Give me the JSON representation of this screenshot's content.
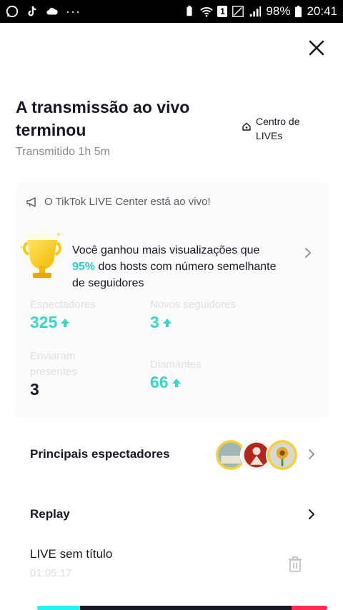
{
  "status_bar": {
    "icons_left": [
      "whatsapp-icon",
      "tiktok-icon",
      "cloud-icon"
    ],
    "more_dots": "···",
    "sim_badge": "1",
    "battery": "98%",
    "time": "20:41"
  },
  "header": {
    "title": "A transmissão ao vivo terminou",
    "duration": "Transmitido 1h 5m",
    "live_center_label": "Centro de LIVEs"
  },
  "card": {
    "notice": "O TikTok LIVE Center está ao vivo!",
    "achievement_prefix": "Você ganhou mais visualizações que ",
    "achievement_percent": "95%",
    "achievement_suffix": " dos hosts com número semelhante de seguidores",
    "stats": {
      "viewers_label": "Espectadores",
      "viewers_value": "325",
      "new_followers_label": "Novos seguidores",
      "new_followers_value": "3",
      "gifters_label": "Enviaram presentes",
      "gifters_value": "3",
      "diamonds_label": "Diamantes",
      "diamonds_value": "66"
    }
  },
  "rows": {
    "top_viewers": "Principais espectadores",
    "replay": "Replay"
  },
  "replay_item": {
    "title": "LIVE sem título",
    "time": "01:05:17"
  },
  "colors": {
    "accent_teal": "#20d5c4",
    "tiktok_cyan": "#25f4ee",
    "tiktok_red": "#fe2c55"
  }
}
